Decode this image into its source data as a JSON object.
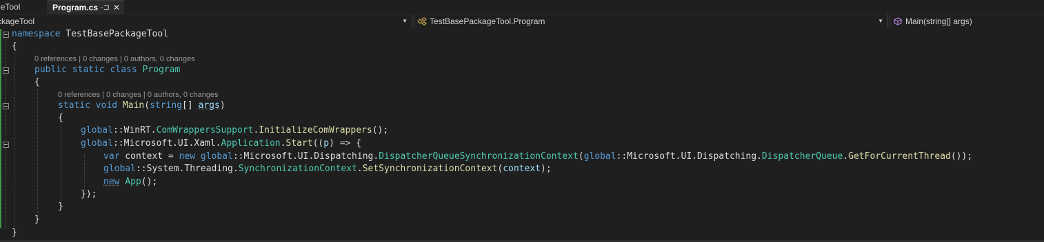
{
  "tabs": {
    "previous_partial": "geTool",
    "active_title": "Program.cs",
    "pin_glyph": "-⊐",
    "close_glyph": "✕"
  },
  "navigation": {
    "project": "ckageTool",
    "class": "TestBasePackageTool.Program",
    "member": "Main(string[] args)"
  },
  "code": {
    "l1_kw": "namespace",
    "l1_name": "TestBasePackageTool",
    "brace_open": "{",
    "brace_close": "}",
    "lens1": "0 references | 0 changes | 0 authors, 0 changes",
    "l2_kw": "public static class",
    "l2_name": "Program",
    "lens2": "0 references | 0 changes | 0 authors, 0 changes",
    "l3_kw": "static void",
    "l3_fn": "Main",
    "l3_open": "(",
    "l3_type": "string",
    "l3_arr": "[] ",
    "l3_param": "args",
    "l3_close": ")",
    "s1_global": "global",
    "s1_sep": "::WinRT.",
    "s1_cls": "ComWrappersSupport",
    "s1_dot": ".",
    "s1_fn": "InitializeComWrappers",
    "s1_end": "();",
    "s2_global": "global",
    "s2_sep": "::Microsoft.UI.Xaml.",
    "s2_cls": "Application",
    "s2_dot": ".",
    "s2_fn": "Start",
    "s2_open": "((",
    "s2_p": "p",
    "s2_end": ") => {",
    "s3_var": "var",
    "s3_name": " context = ",
    "s3_new": "new",
    "s3_sp": " ",
    "s3_global": "global",
    "s3_sep": "::Microsoft.UI.Dispatching.",
    "s3_cls": "DispatcherQueueSynchronizationContext",
    "s3_open": "(",
    "s3_global2": "global",
    "s3_sep2": "::Microsoft.UI.Dispatching.",
    "s3_cls2": "DispatcherQueue",
    "s3_dot": ".",
    "s3_fn": "GetForCurrentThread",
    "s3_end": "());",
    "s4_global": "global",
    "s4_sep": "::System.Threading.",
    "s4_cls": "SynchronizationContext",
    "s4_dot": ".",
    "s4_fn": "SetSynchronizationContext",
    "s4_open": "(",
    "s4_arg": "context",
    "s4_end": ");",
    "s5_new": "new",
    "s5_sp": " ",
    "s5_cls": "App",
    "s5_end": "();",
    "s6": "});"
  },
  "colors": {
    "keyword": "#569cd6",
    "type": "#4ec9b0",
    "method": "#dcdcaa",
    "parameter": "#9cdcfe",
    "change_bar": "#3f9a4a"
  }
}
